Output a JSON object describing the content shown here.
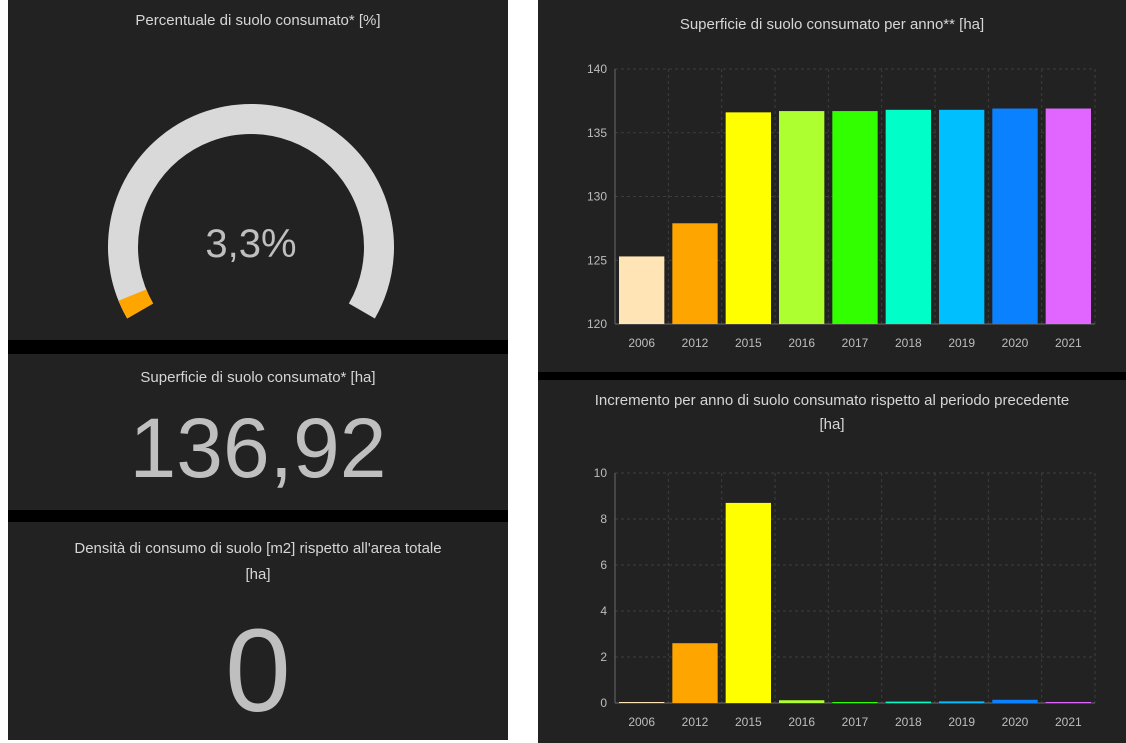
{
  "left": {
    "gauge": {
      "title": "Percentuale di suolo consumato* [%]",
      "value_label": "3,3%",
      "percent": 3.3,
      "track_color": "#d9d9d9",
      "fill_color": "#ffa500"
    },
    "surface": {
      "title": "Superficie di suolo consumato* [ha]",
      "value": "136,92"
    },
    "density": {
      "title_line1": "Densità di consumo di suolo [m2] rispetto all'area totale",
      "title_line2": "[ha]",
      "value": "0"
    }
  },
  "chart_data": [
    {
      "type": "bar",
      "title": "Superficie di suolo consumato per anno** [ha]",
      "categories": [
        "2006",
        "2012",
        "2015",
        "2016",
        "2017",
        "2018",
        "2019",
        "2020",
        "2021"
      ],
      "values": [
        125.3,
        127.9,
        136.6,
        136.7,
        136.7,
        136.8,
        136.8,
        136.9,
        136.9
      ],
      "colors": [
        "#ffe4b5",
        "#ffa500",
        "#ffff00",
        "#adff2f",
        "#32ff00",
        "#00ffc8",
        "#00bfff",
        "#0a82ff",
        "#e066ff"
      ],
      "ylim": [
        120,
        140
      ],
      "yticks": [
        120,
        125,
        130,
        135,
        140
      ],
      "grid": true,
      "xlabel": "",
      "ylabel": ""
    },
    {
      "type": "bar",
      "title_line1": "Incremento per anno di suolo consumato rispetto al periodo precedente",
      "title_line2": "[ha]",
      "categories": [
        "2006",
        "2012",
        "2015",
        "2016",
        "2017",
        "2018",
        "2019",
        "2020",
        "2021"
      ],
      "values": [
        0.02,
        2.6,
        8.7,
        0.12,
        0.04,
        0.06,
        0.07,
        0.14,
        0.03
      ],
      "colors": [
        "#ffe4b5",
        "#ffa500",
        "#ffff00",
        "#adff2f",
        "#32ff00",
        "#00ffc8",
        "#00bfff",
        "#0a82ff",
        "#e066ff"
      ],
      "ylim": [
        0,
        10
      ],
      "yticks": [
        0,
        2,
        4,
        6,
        8,
        10
      ],
      "grid": true,
      "xlabel": "",
      "ylabel": ""
    }
  ]
}
